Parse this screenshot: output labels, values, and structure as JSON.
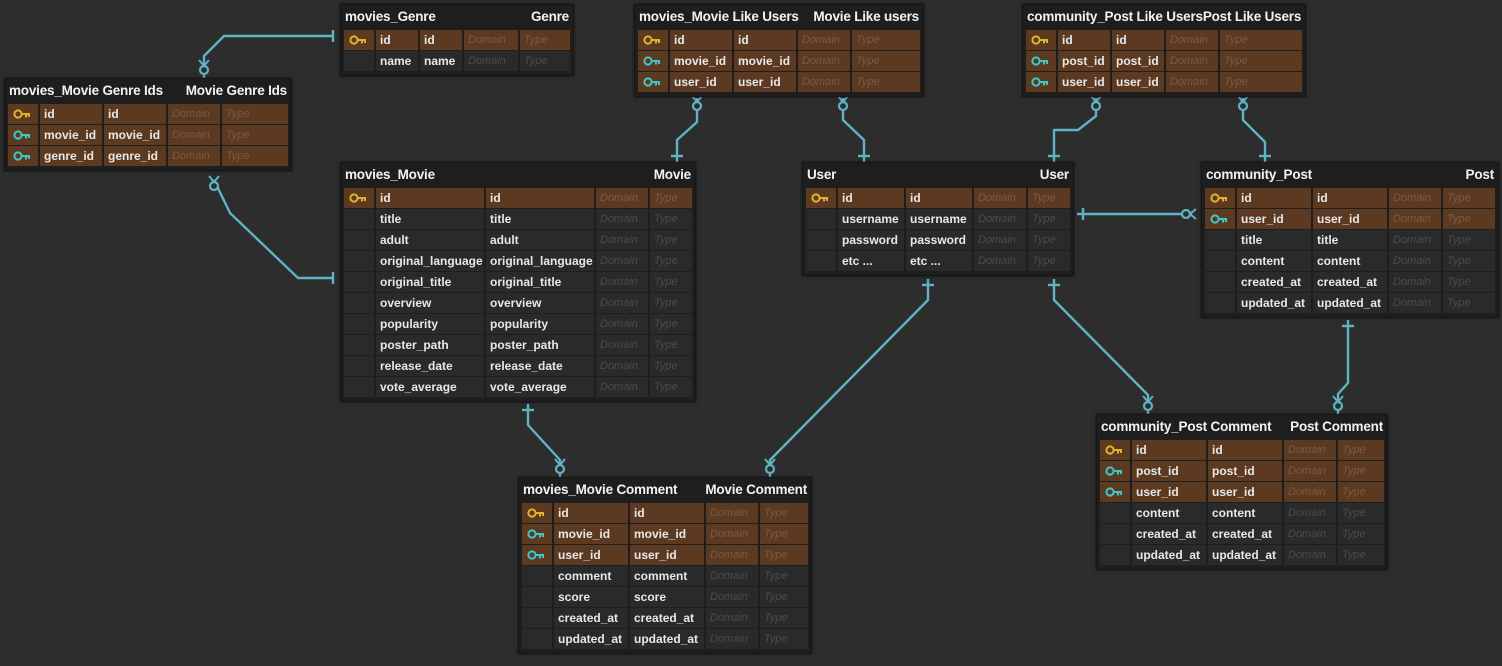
{
  "entities": [
    {
      "id": "movies_genre",
      "name": "movies_Genre",
      "label": "Genre",
      "cols": [
        30,
        42,
        42,
        54,
        50
      ],
      "rows": [
        {
          "icon": "pk",
          "name": "id",
          "code": "id",
          "domain": "Domain",
          "type": "Type"
        },
        {
          "icon": "",
          "name": "name",
          "code": "name",
          "domain": "Domain",
          "type": "Type"
        }
      ]
    },
    {
      "id": "movie_genre_ids",
      "name": "movies_Movie Genre Ids",
      "label": "Movie Genre Ids",
      "cols": [
        30,
        62,
        62,
        52,
        66
      ],
      "rows": [
        {
          "icon": "pk",
          "name": "id",
          "code": "id",
          "domain": "Domain",
          "type": "Type"
        },
        {
          "icon": "fk",
          "name": "movie_id",
          "code": "movie_id",
          "domain": "Domain",
          "type": "Type"
        },
        {
          "icon": "fk",
          "name": "genre_id",
          "code": "genre_id",
          "domain": "Domain",
          "type": "Type"
        }
      ]
    },
    {
      "id": "movie_like_users",
      "name": "movies_Movie Like Users",
      "label": "Movie Like users",
      "cols": [
        30,
        62,
        62,
        52,
        68
      ],
      "rows": [
        {
          "icon": "pk",
          "name": "id",
          "code": "id",
          "domain": "Domain",
          "type": "Type"
        },
        {
          "icon": "fk",
          "name": "movie_id",
          "code": "movie_id",
          "domain": "Domain",
          "type": "Type"
        },
        {
          "icon": "fk",
          "name": "user_id",
          "code": "user_id",
          "domain": "Domain",
          "type": "Type"
        }
      ]
    },
    {
      "id": "post_like_users",
      "name": "community_Post Like Users",
      "label": "Post Like Users",
      "cols": [
        30,
        52,
        52,
        52,
        82
      ],
      "rows": [
        {
          "icon": "pk",
          "name": "id",
          "code": "id",
          "domain": "Domain",
          "type": "Type"
        },
        {
          "icon": "fk",
          "name": "post_id",
          "code": "post_id",
          "domain": "Domain",
          "type": "Type"
        },
        {
          "icon": "fk",
          "name": "user_id",
          "code": "user_id",
          "domain": "Domain",
          "type": "Type"
        }
      ]
    },
    {
      "id": "movie",
      "name": "movies_Movie",
      "label": "Movie",
      "cols": [
        30,
        108,
        108,
        52,
        42
      ],
      "rows": [
        {
          "icon": "pk",
          "name": "id",
          "code": "id",
          "domain": "Domain",
          "type": "Type"
        },
        {
          "icon": "",
          "name": "title",
          "code": "title",
          "domain": "Domain",
          "type": "Type"
        },
        {
          "icon": "",
          "name": "adult",
          "code": "adult",
          "domain": "Domain",
          "type": "Type"
        },
        {
          "icon": "",
          "name": "original_language",
          "code": "original_language",
          "domain": "Domain",
          "type": "Type"
        },
        {
          "icon": "",
          "name": "original_title",
          "code": "original_title",
          "domain": "Domain",
          "type": "Type"
        },
        {
          "icon": "",
          "name": "overview",
          "code": "overview",
          "domain": "Domain",
          "type": "Type"
        },
        {
          "icon": "",
          "name": "popularity",
          "code": "popularity",
          "domain": "Domain",
          "type": "Type"
        },
        {
          "icon": "",
          "name": "poster_path",
          "code": "poster_path",
          "domain": "Domain",
          "type": "Type"
        },
        {
          "icon": "",
          "name": "release_date",
          "code": "release_date",
          "domain": "Domain",
          "type": "Type"
        },
        {
          "icon": "",
          "name": "vote_average",
          "code": "vote_average",
          "domain": "Domain",
          "type": "Type"
        }
      ]
    },
    {
      "id": "user",
      "name": "User",
      "label": "User",
      "cols": [
        30,
        66,
        66,
        52,
        42
      ],
      "rows": [
        {
          "icon": "pk",
          "name": "id",
          "code": "id",
          "domain": "Domain",
          "type": "Type"
        },
        {
          "icon": "",
          "name": "username",
          "code": "username",
          "domain": "Domain",
          "type": "Type"
        },
        {
          "icon": "",
          "name": "password",
          "code": "password",
          "domain": "Domain",
          "type": "Type"
        },
        {
          "icon": "",
          "name": "etc ...",
          "code": "etc ...",
          "domain": "Domain",
          "type": "Type"
        }
      ]
    },
    {
      "id": "post",
      "name": "community_Post",
      "label": "Post",
      "cols": [
        30,
        74,
        74,
        52,
        52
      ],
      "rows": [
        {
          "icon": "pk",
          "name": "id",
          "code": "id",
          "domain": "Domain",
          "type": "Type"
        },
        {
          "icon": "fk",
          "name": "user_id",
          "code": "user_id",
          "domain": "Domain",
          "type": "Type"
        },
        {
          "icon": "",
          "name": "title",
          "code": "title",
          "domain": "Domain",
          "type": "Type"
        },
        {
          "icon": "",
          "name": "content",
          "code": "content",
          "domain": "Domain",
          "type": "Type"
        },
        {
          "icon": "",
          "name": "created_at",
          "code": "created_at",
          "domain": "Domain",
          "type": "Type"
        },
        {
          "icon": "",
          "name": "updated_at",
          "code": "updated_at",
          "domain": "Domain",
          "type": "Type"
        }
      ]
    },
    {
      "id": "movie_comment",
      "name": "movies_Movie Comment",
      "label": "Movie Comment",
      "cols": [
        30,
        74,
        74,
        52,
        48
      ],
      "rows": [
        {
          "icon": "pk",
          "name": "id",
          "code": "id",
          "domain": "Domain",
          "type": "Type"
        },
        {
          "icon": "fk",
          "name": "movie_id",
          "code": "movie_id",
          "domain": "Domain",
          "type": "Type"
        },
        {
          "icon": "fk",
          "name": "user_id",
          "code": "user_id",
          "domain": "Domain",
          "type": "Type"
        },
        {
          "icon": "",
          "name": "comment",
          "code": "comment",
          "domain": "Domain",
          "type": "Type"
        },
        {
          "icon": "",
          "name": "score",
          "code": "score",
          "domain": "Domain",
          "type": "Type"
        },
        {
          "icon": "",
          "name": "created_at",
          "code": "created_at",
          "domain": "Domain",
          "type": "Type"
        },
        {
          "icon": "",
          "name": "updated_at",
          "code": "updated_at",
          "domain": "Domain",
          "type": "Type"
        }
      ]
    },
    {
      "id": "post_comment",
      "name": "community_Post Comment",
      "label": "Post Comment",
      "cols": [
        30,
        74,
        74,
        52,
        46
      ],
      "rows": [
        {
          "icon": "pk",
          "name": "id",
          "code": "id",
          "domain": "Domain",
          "type": "Type"
        },
        {
          "icon": "fk",
          "name": "post_id",
          "code": "post_id",
          "domain": "Domain",
          "type": "Type"
        },
        {
          "icon": "fk",
          "name": "user_id",
          "code": "user_id",
          "domain": "Domain",
          "type": "Type"
        },
        {
          "icon": "",
          "name": "content",
          "code": "content",
          "domain": "Domain",
          "type": "Type"
        },
        {
          "icon": "",
          "name": "created_at",
          "code": "created_at",
          "domain": "Domain",
          "type": "Type"
        },
        {
          "icon": "",
          "name": "updated_at",
          "code": "updated_at",
          "domain": "Domain",
          "type": "Type"
        }
      ]
    }
  ],
  "relationships": [
    {
      "from": "movies_genre",
      "to": "movie_genre_ids",
      "from_card": "one",
      "to_card": "zero-or-many"
    },
    {
      "from": "movie",
      "to": "movie_genre_ids",
      "from_card": "one",
      "to_card": "zero-or-many"
    },
    {
      "from": "movie",
      "to": "movie_like_users",
      "from_card": "one",
      "to_card": "zero-or-many"
    },
    {
      "from": "user",
      "to": "movie_like_users",
      "from_card": "one",
      "to_card": "zero-or-many"
    },
    {
      "from": "user",
      "to": "post_like_users",
      "from_card": "one",
      "to_card": "zero-or-many"
    },
    {
      "from": "post",
      "to": "post_like_users",
      "from_card": "one",
      "to_card": "zero-or-many"
    },
    {
      "from": "user",
      "to": "post",
      "from_card": "one",
      "to_card": "zero-or-many"
    },
    {
      "from": "movie",
      "to": "movie_comment",
      "from_card": "one",
      "to_card": "zero-or-many"
    },
    {
      "from": "user",
      "to": "movie_comment",
      "from_card": "one",
      "to_card": "zero-or-many"
    },
    {
      "from": "user",
      "to": "post_comment",
      "from_card": "one",
      "to_card": "zero-or-many"
    },
    {
      "from": "post",
      "to": "post_comment",
      "from_card": "one",
      "to_card": "zero-or-many"
    }
  ],
  "colors": {
    "background": "#2d2d2d",
    "connector": "#5fb4c4",
    "key_row": "#5c3a22",
    "pk_icon": "#e0b32a",
    "fk_icon": "#3fc6c6"
  }
}
